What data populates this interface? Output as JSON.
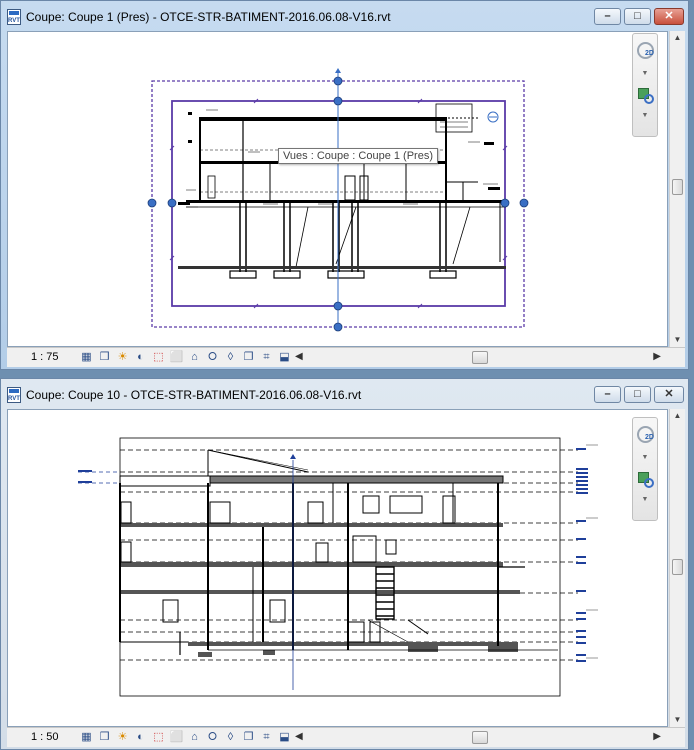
{
  "window1": {
    "title": "Coupe: Coupe 1 (Pres) - OTCE-STR-BATIMENT-2016.06.08-V16.rvt",
    "scale": "1 : 75",
    "tooltip": "Vues : Coupe : Coupe 1 (Pres)",
    "icon_label": "RVT"
  },
  "window2": {
    "title": "Coupe: Coupe 10 - OTCE-STR-BATIMENT-2016.06.08-V16.rvt",
    "scale": "1 : 50",
    "icon_label": "RVT"
  },
  "controls": {
    "minimize": "–",
    "restore": "□",
    "close": "✕"
  },
  "icons": {
    "view_control_bar": [
      "detail-level-icon",
      "visual-style-icon",
      "sun-path-icon",
      "shadows-icon",
      "crop-region-icon",
      "show-crop-icon",
      "lock-3d-icon",
      "temporary-hide-icon",
      "reveal-hidden-icon",
      "temporary-view-properties-icon",
      "analytical-model-icon",
      "highlight-displacement-icon"
    ],
    "view_control_glyphs": [
      "▦",
      "❒",
      "☀",
      "◐",
      "⬚",
      "⬜",
      "⌂",
      "⭘",
      "◊",
      "❐",
      "⌗",
      "⬓"
    ]
  },
  "colors": {
    "selection_purple": "#5a3aa8",
    "grip_blue": "#3a6fc4",
    "level_blue": "#1f3f9a",
    "title_active": "#c6dbf0",
    "title_inactive": "#dfe8f1"
  }
}
